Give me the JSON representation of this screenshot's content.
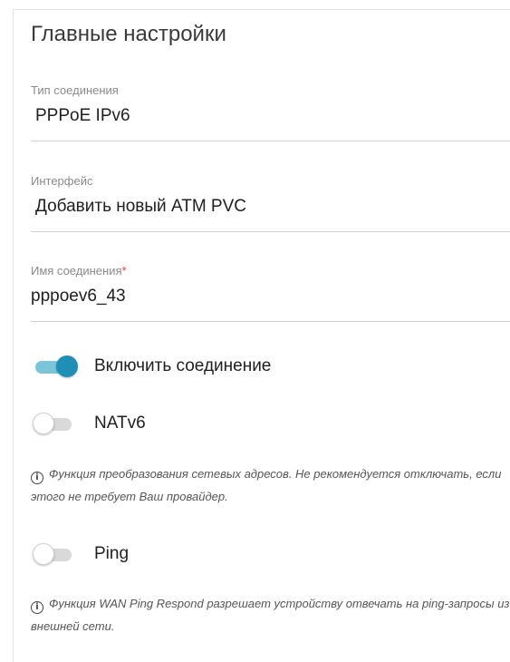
{
  "section": {
    "title": "Главные настройки"
  },
  "fields": [
    {
      "label": "Тип соединения",
      "value": "PPPoE IPv6",
      "required": false
    },
    {
      "label": "Интерфейс",
      "value": "Добавить новый ATM PVC",
      "required": false
    },
    {
      "label": "Имя соединения",
      "value": "pppoev6_43",
      "required": true,
      "required_mark": "*"
    }
  ],
  "toggles": [
    {
      "label": "Включить соединение",
      "state": "on"
    },
    {
      "label": "NATv6",
      "state": "off"
    },
    {
      "label": "Ping",
      "state": "off"
    }
  ],
  "hints": [
    {
      "icon": "info-icon",
      "text": "Функция преобразования сетевых адресов. Не рекомендуется отключать, если этого не требует Ваш провайдер."
    },
    {
      "icon": "info-icon",
      "text": "Функция WAN Ping Respond разрешает устройству отвечать на ping-запросы из внешней сети."
    }
  ],
  "colors": {
    "accent": "#1f8fb5",
    "accent_track": "#7cc4d8",
    "required": "#e0433a"
  }
}
